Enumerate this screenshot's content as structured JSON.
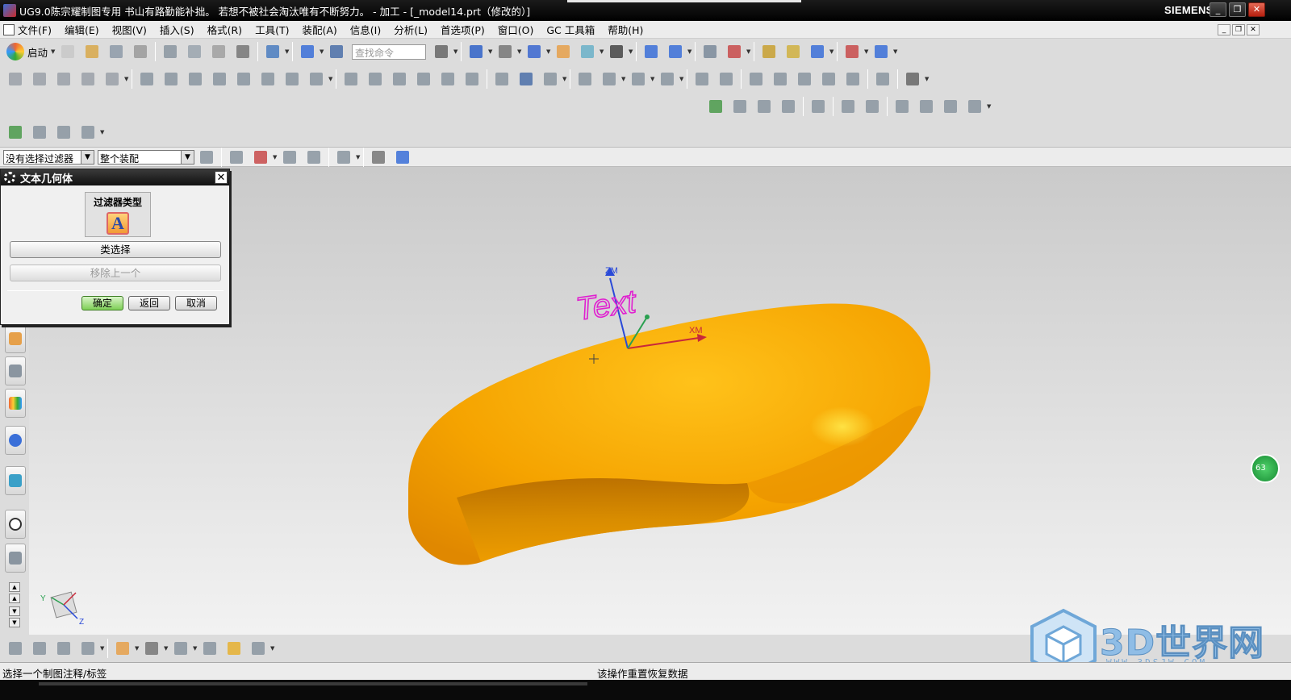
{
  "window": {
    "title": "UG9.0陈宗耀制图专用 书山有路勤能补拙。 若想不被社会淘汰唯有不断努力。 - 加工 - [_model14.prt（修改的）]",
    "brand": "SIEMENS",
    "controls": [
      "_",
      "❐",
      "✕"
    ]
  },
  "menu": {
    "items": [
      "文件(F)",
      "编辑(E)",
      "视图(V)",
      "插入(S)",
      "格式(R)",
      "工具(T)",
      "装配(A)",
      "信息(I)",
      "分析(L)",
      "首选项(P)",
      "窗口(O)",
      "GC 工具箱",
      "帮助(H)"
    ]
  },
  "toolbar": {
    "start_label": "启动",
    "search_placeholder": "查找命令"
  },
  "selection_bar": {
    "filter": "没有选择过滤器",
    "scope": "整个装配"
  },
  "dialog": {
    "title": "文本几何体",
    "filter_type_label": "过滤器类型",
    "filter_icon_letter": "A",
    "class_select": "类选择",
    "remove_previous": "移除上一个",
    "ok": "确定",
    "back": "返回",
    "cancel": "取消"
  },
  "viewport": {
    "part_color": "#f5a000",
    "annotation_text": "Text",
    "annotation_color": "#e020d0",
    "axis_zm": "ZM",
    "axis_xm": "XM",
    "triad_y": "Y",
    "triad_z": "Z",
    "badge": "63"
  },
  "status": {
    "left": "选择一个制图注释/标签",
    "right": "该操作重置恢复数据"
  },
  "watermark": {
    "title": "3D世界网",
    "url": "WWW.3DSJW.COM"
  }
}
